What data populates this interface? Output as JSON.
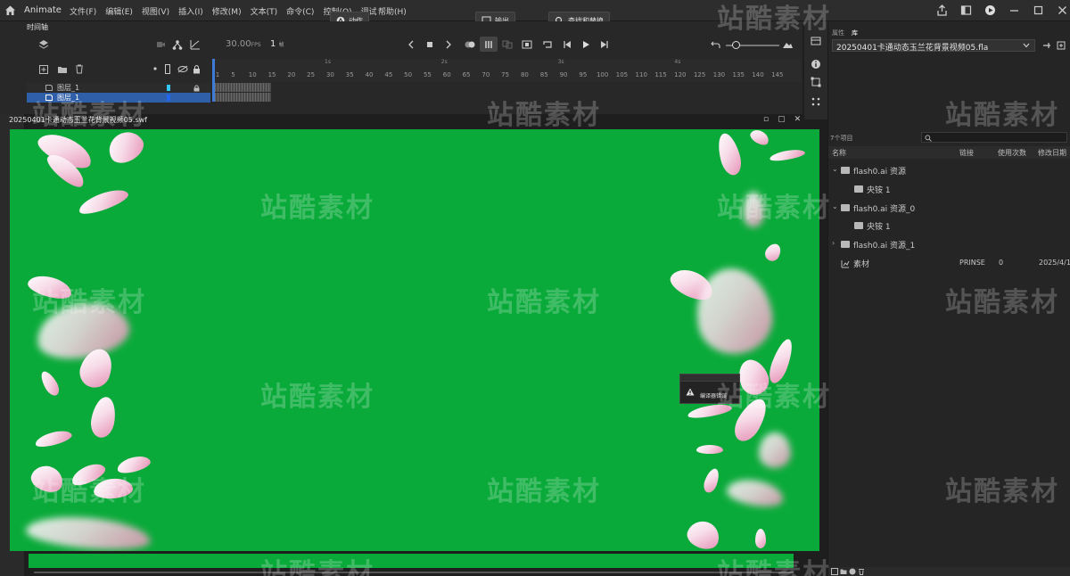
{
  "menubar": {
    "app_name": "Animate",
    "menus": [
      "文件(F)",
      "编辑(E)",
      "视图(V)",
      "插入(I)",
      "修改(M)",
      "文本(T)",
      "命令(C)",
      "控制(O)",
      "调试"
    ],
    "help": "帮助(H)"
  },
  "toolbar": {
    "motion_label": "动作",
    "output_label": "输出",
    "find_replace_label": "查找和替换"
  },
  "timeline": {
    "tab_label": "时间轴",
    "fps_value": "30.00",
    "fps_unit": "FPS",
    "current_frame": "1",
    "frame_unit": "帧",
    "seconds": [
      "1s",
      "2s",
      "3s",
      "4s"
    ],
    "ticks": [
      "1",
      "5",
      "10",
      "15",
      "20",
      "25",
      "30",
      "35",
      "40",
      "45",
      "50",
      "55",
      "60",
      "65",
      "70",
      "75",
      "80",
      "85",
      "90",
      "95",
      "100",
      "105",
      "110",
      "115",
      "120",
      "125",
      "130",
      "135",
      "140",
      "145"
    ],
    "layers": [
      {
        "name": "图层_1",
        "color": "#33c6f0"
      },
      {
        "name": "图层_1",
        "color": "#2266ee"
      }
    ]
  },
  "document": {
    "title": "20250401卡通动态玉兰花背景视频05.swf",
    "stage_color": "#0aaa3a",
    "controls": [
      "▫",
      "▢",
      "✕"
    ]
  },
  "error_popup": {
    "message": "编译器错误"
  },
  "library": {
    "tabs": [
      "属性",
      "库"
    ],
    "doc_name": "20250401卡通动态玉兰花背景视频05.fla",
    "item_count": "7个项目",
    "columns": {
      "name": "名称",
      "linkage": "链接",
      "use_count": "使用次数",
      "modified": "修改日期"
    },
    "items": [
      {
        "name": "flash0.ai 资源",
        "type": "folder",
        "expanded": true
      },
      {
        "name": "央铵 1",
        "type": "folder",
        "expanded": false
      },
      {
        "name": "flash0.ai 资源_0",
        "type": "folder",
        "expanded": true
      },
      {
        "name": "央铵 1",
        "type": "folder",
        "expanded": false
      },
      {
        "name": "flash0.ai 资源_1",
        "type": "folder",
        "expanded": false
      },
      {
        "name": "素材",
        "type": "symbol",
        "linkage": "PRINSE",
        "use_count": "0",
        "modified": "2025/4/1"
      }
    ]
  },
  "watermark": "站酷素材"
}
